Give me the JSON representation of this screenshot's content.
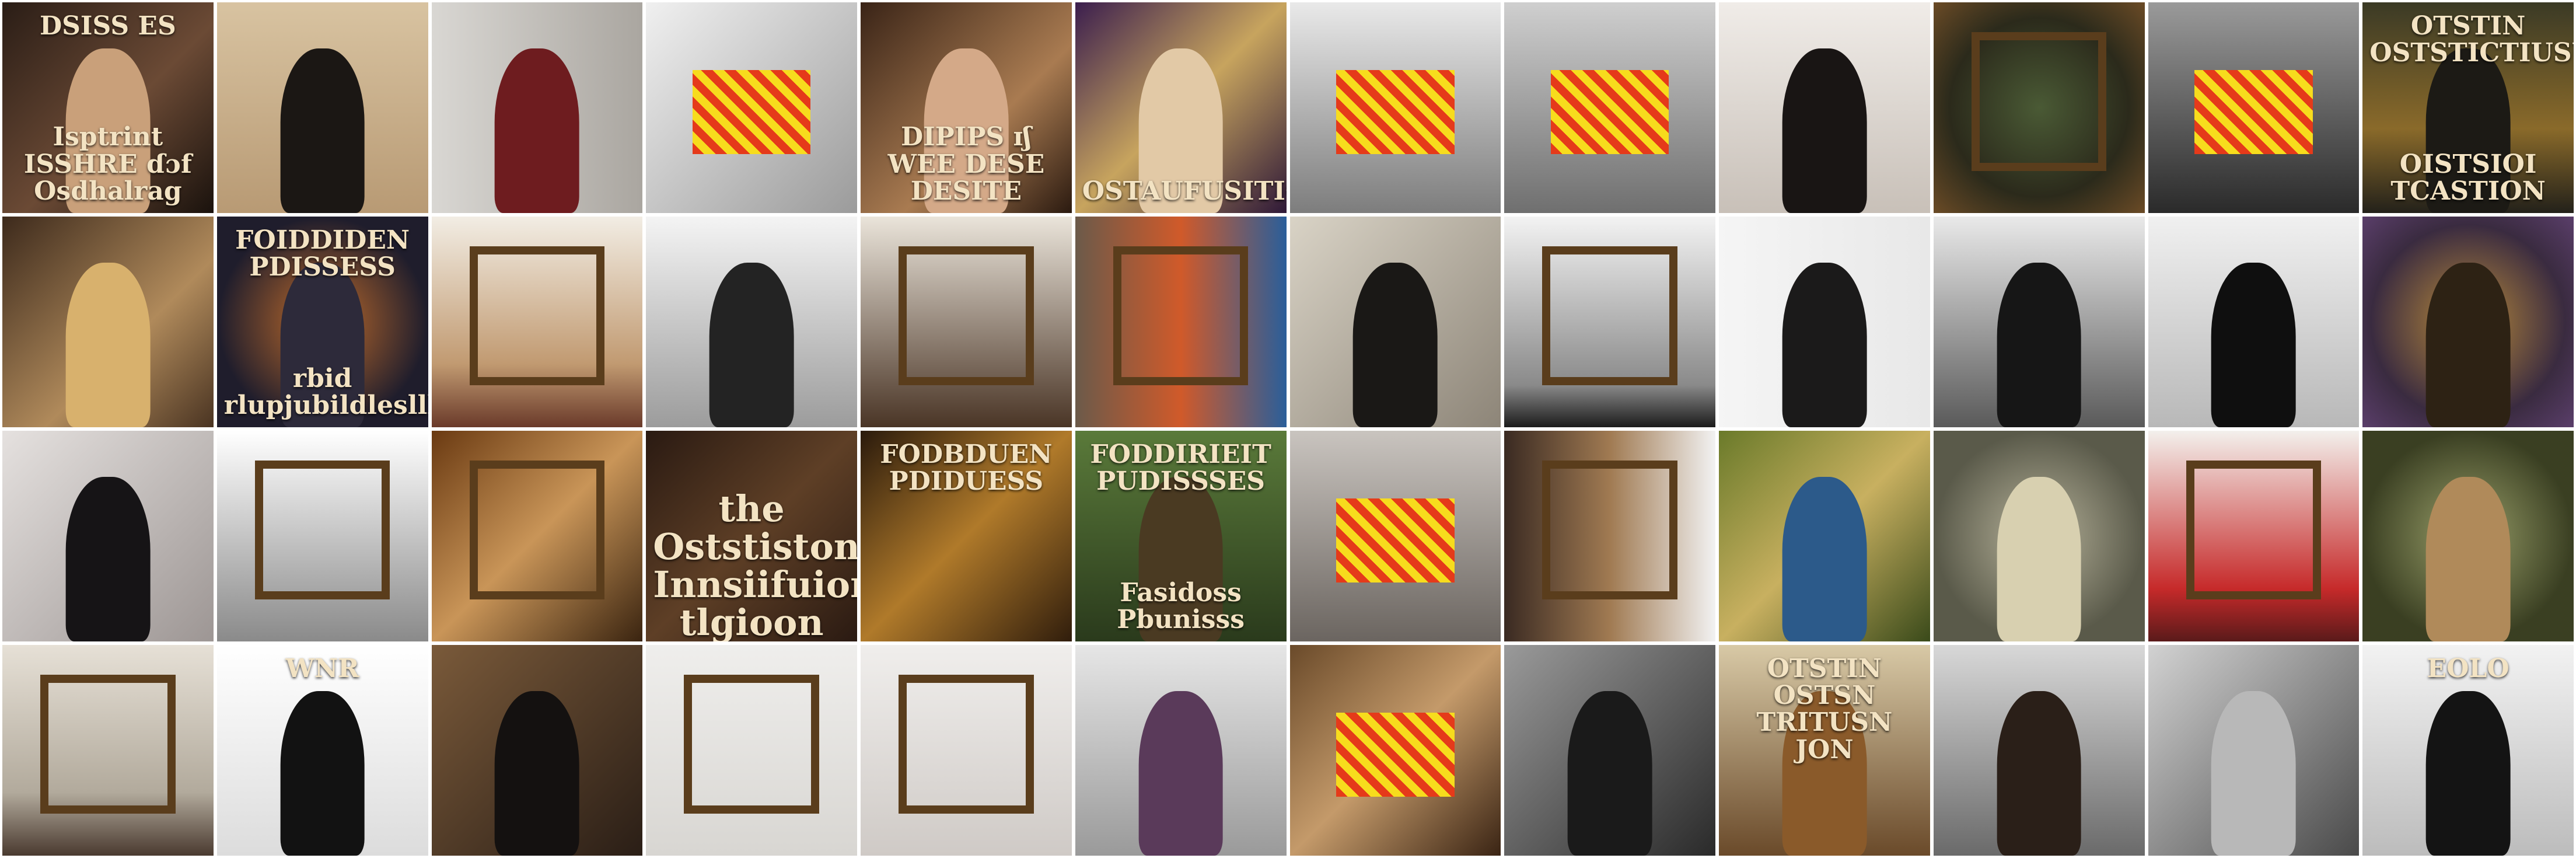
{
  "grid": {
    "rows": 4,
    "columns": 12,
    "tiles": [
      {
        "bg": "linear-gradient(135deg,#2a1d16,#6b4a35 55%,#1a120d)",
        "caption_top": "DSISS ES",
        "caption_bottom": "Isptrint\nISSHRE ɗɔf\nOsdhalrag",
        "figure": "#c9a07a"
      },
      {
        "bg": "linear-gradient(180deg,#d8c3a1,#b89a74)",
        "figure": "#1b1714"
      },
      {
        "bg": "linear-gradient(90deg,#d9d7d3,#aaa6a0)",
        "figure": "#6e1c1f"
      },
      {
        "bg": "linear-gradient(135deg,#f0f0f0,#9b9b9b)",
        "redact": true
      },
      {
        "bg": "linear-gradient(135deg,#3a2417,#a97b51 60%,#2b1a10)",
        "caption_bottom": "DIPIPS ɪʃ\nWEE DESE DESITE",
        "figure": "#d4a988"
      },
      {
        "bg": "linear-gradient(135deg,#3b1e4e,#c7a45e 50%,#2e1838)",
        "caption_bottom": "OSTAUFUSITIONG",
        "figure": "#e2c9a6"
      },
      {
        "bg": "linear-gradient(180deg,#e9e9e9,#7d7d7d)",
        "redact": true
      },
      {
        "bg": "linear-gradient(180deg,#cfcfcf,#6f6f6f)",
        "redact": true
      },
      {
        "bg": "linear-gradient(180deg,#f0ece8,#c8c0b8)",
        "figure": "#191514"
      },
      {
        "bg": "radial-gradient(circle,#4a5a35,#2b2a1b 60%,#6b4b26)",
        "frame": true
      },
      {
        "bg": "linear-gradient(180deg,#9a9a9a,#2a2a2a)",
        "redact": true
      },
      {
        "bg": "linear-gradient(180deg,#3b3a25,#8a6a2a 60%,#23211a)",
        "caption_top": "OTSTIN\nOSTSTICTIUSUSNTION",
        "caption_bottom": "OISTSIOI TCASTION",
        "figure": "#1c1a15"
      },
      {
        "bg": "linear-gradient(135deg,#3d2a1c,#b08a5b 60%,#4a3422)",
        "figure": "#d8b16d"
      },
      {
        "bg": "radial-gradient(circle,#c26d2b,#1f1d2c 70%)",
        "caption_top": "FOIDDIDEN PDISSESS",
        "caption_bottom": "rbid rlupjubildlesllldsmets",
        "figure": "#2d2a3a"
      },
      {
        "bg": "linear-gradient(180deg,#f2ede4,#c19a71 70%,#6a3a2a)",
        "frame": true
      },
      {
        "bg": "linear-gradient(180deg,#f4f4f4,#9c9c9c)",
        "figure": "#232323"
      },
      {
        "bg": "linear-gradient(180deg,#eae4da,#4a3526)",
        "frame": true
      },
      {
        "bg": "linear-gradient(90deg,#6b5a4a,#d05a2a 50%,#2a5e9a)",
        "frame": true
      },
      {
        "bg": "linear-gradient(135deg,#d9d3c6,#8d8578)",
        "figure": "#1a1816"
      },
      {
        "bg": "linear-gradient(180deg,#f3f3f3,#8a8a8a 80%,#1c1c1c)",
        "frame": true
      },
      {
        "bg": "linear-gradient(90deg,#f5f5f5,#e8e8e8)",
        "figure": "#1b1a1a"
      },
      {
        "bg": "linear-gradient(180deg,#e9e9e9,#5a5a5a)",
        "figure": "#161616"
      },
      {
        "bg": "linear-gradient(180deg,#f0f0f0,#b8b8b8)",
        "figure": "#0f0f0f"
      },
      {
        "bg": "radial-gradient(circle,#b88a3a,#3a2b40 65%,#5a3e6a)",
        "figure": "#2d2214"
      },
      {
        "bg": "linear-gradient(135deg,#e5e1df,#9d9694)",
        "figure": "#161416"
      },
      {
        "bg": "linear-gradient(180deg,#ffffff,#8a8a8a)",
        "frame": true
      },
      {
        "bg": "linear-gradient(135deg,#6a3a12,#c99558 50%,#3a2410)",
        "frame": true
      },
      {
        "bg": "linear-gradient(135deg,#2a1a12,#5e3f26 50%,#2a1a12)",
        "caption_mid": "the\nOststiston\nInnsiifuion\ntlgioon"
      },
      {
        "bg": "linear-gradient(135deg,#2a1a0c,#b07a2a 50%,#301d0c)",
        "caption_top": "FODBDUEN PDIDUESS"
      },
      {
        "bg": "linear-gradient(180deg,#5a7a3a,#2a3a1c)",
        "caption_top": "FODDIRIEIT PUDISSSES",
        "caption_bottom": "Fasidoss Pbunisss",
        "figure": "#4a3a22"
      },
      {
        "bg": "linear-gradient(180deg,#c9c4bf,#6b6560)",
        "redact": true
      },
      {
        "bg": "linear-gradient(90deg,#3a2a22,#a07a52 50%,#f2f2f2)",
        "frame": true
      },
      {
        "bg": "linear-gradient(135deg,#6a7a2a,#c8b060 50%,#3a4a1a)",
        "figure": "#2c5a8a"
      },
      {
        "bg": "radial-gradient(circle,#b6b29a,#5a5a4a 70%)",
        "figure": "#d8d0b0"
      },
      {
        "bg": "linear-gradient(180deg,#f3f0ec,#c62a2a 75%,#5a1a1a)",
        "frame": true
      },
      {
        "bg": "radial-gradient(circle,#9aa06a,#3a3f22 70%)",
        "figure": "#b08a5a"
      },
      {
        "bg": "linear-gradient(180deg,#e6e0d6,#b2aa9c 70%,#4a3a30)",
        "frame": true
      },
      {
        "bg": "linear-gradient(180deg,#ffffff,#dcdcdc)",
        "caption_top": "WNR",
        "figure": "#121212"
      },
      {
        "bg": "linear-gradient(135deg,#7a5a3a,#2a1e16)",
        "figure": "#141110"
      },
      {
        "bg": "linear-gradient(180deg,#efeeec,#d8d6d2)",
        "frame": true
      },
      {
        "bg": "linear-gradient(180deg,#f0eeec,#cfcac6)",
        "frame": true
      },
      {
        "bg": "linear-gradient(180deg,#e6e6e6,#9a9a9a)",
        "figure": "#5a3a5a"
      },
      {
        "bg": "linear-gradient(135deg,#6a4a2a,#c49a6a 50%,#3a2414)",
        "redact": true
      },
      {
        "bg": "linear-gradient(135deg,#9a9a9a,#2a2a2a)",
        "figure": "#1a1a1a"
      },
      {
        "bg": "linear-gradient(180deg,#d8c9a6,#6a4a2a)",
        "caption_top": "OTSTIN\nOSTSN\nTRITUSN\nJON",
        "figure": "#8a5a2a"
      },
      {
        "bg": "linear-gradient(180deg,#d8d8d8,#6a6a6a)",
        "figure": "#2a1f18"
      },
      {
        "bg": "linear-gradient(135deg,#d2d2d2,#4a4a4a)",
        "figure": "#b8b8b8"
      },
      {
        "bg": "linear-gradient(180deg,#f2f2f2,#bcbcbc)",
        "caption_top": "EOLO",
        "figure": "#141414"
      }
    ]
  }
}
